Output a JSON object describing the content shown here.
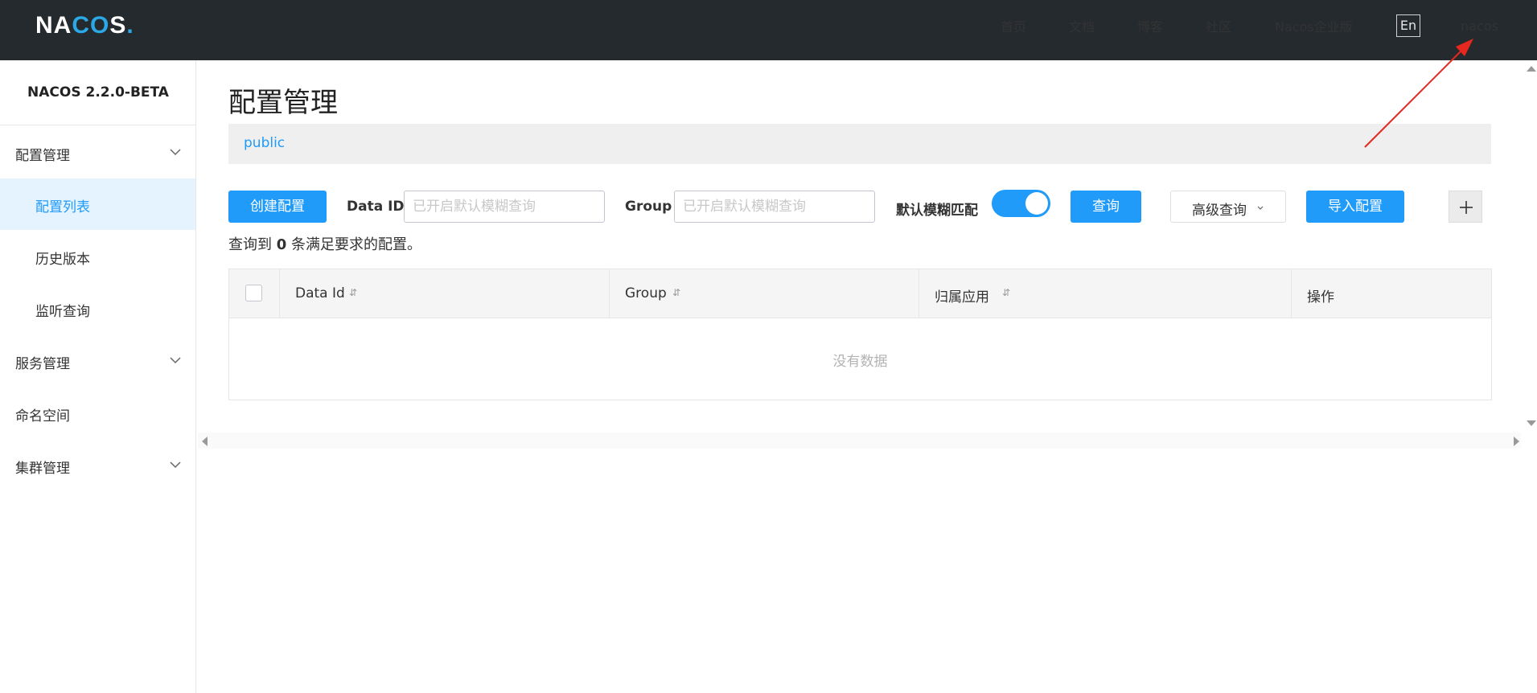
{
  "header": {
    "logo_text": "NACOS.",
    "nav": {
      "home": "首页",
      "docs": "文档",
      "blog": "博客",
      "community": "社区",
      "enterprise": "Nacos企业版"
    },
    "lang_button": "En",
    "user": "nacos"
  },
  "sidebar": {
    "version": "NACOS 2.2.0-BETA",
    "items": [
      {
        "label": "配置管理"
      },
      {
        "label": "配置列表"
      },
      {
        "label": "历史版本"
      },
      {
        "label": "监听查询"
      },
      {
        "label": "服务管理"
      },
      {
        "label": "命名空间"
      },
      {
        "label": "集群管理"
      }
    ]
  },
  "main": {
    "title": "配置管理",
    "namespace": "public",
    "toolbar": {
      "create_label": "创建配置",
      "data_id_label": "Data ID",
      "data_id_placeholder": "已开启默认模糊查询",
      "group_label": "Group",
      "group_placeholder": "已开启默认模糊查询",
      "fuzzy_label": "默认模糊匹配",
      "fuzzy_enabled": true,
      "query_label": "查询",
      "advanced_label": "高级查询",
      "import_label": "导入配置",
      "plus_symbol": "+"
    },
    "result": {
      "prefix": "查询到",
      "count": "0",
      "suffix": "条满足要求的配置。"
    },
    "table": {
      "columns": {
        "data_id": "Data Id",
        "group": "Group",
        "app": "归属应用",
        "ops": "操作"
      },
      "sort_glyph": "⇵",
      "empty_text": "没有数据"
    }
  },
  "colors": {
    "primary": "#209bfa",
    "header_bg": "#252a2f",
    "annotation_arrow": "#e8271e"
  }
}
